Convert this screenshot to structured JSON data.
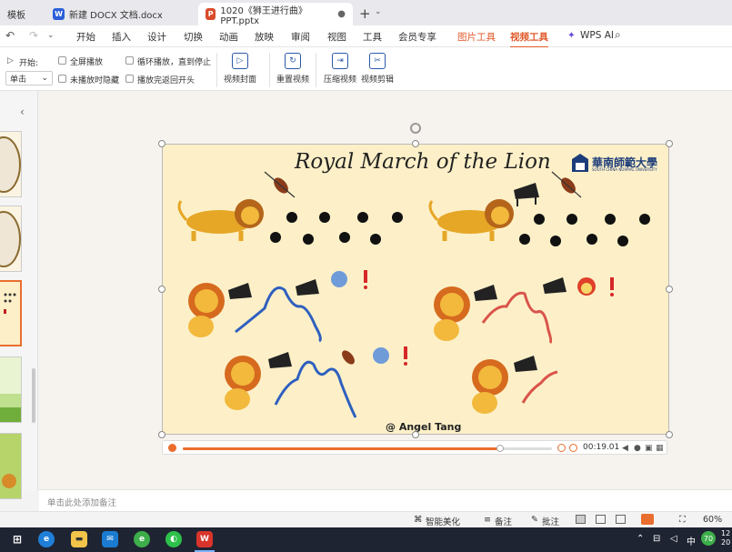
{
  "tabs": [
    {
      "label": "模板",
      "icon": "template-icon"
    },
    {
      "label": "新建 DOCX 文档.docx",
      "badge": "W",
      "badge_color": "#2b5fd9"
    },
    {
      "label": "1020《狮王进行曲》PPT.pptx",
      "badge": "P",
      "badge_color": "#d94b2b",
      "active": true
    }
  ],
  "menu": {
    "items": [
      "开始",
      "插入",
      "设计",
      "切换",
      "动画",
      "放映",
      "审阅",
      "视图",
      "工具",
      "会员专享"
    ],
    "picture_tools": "图片工具",
    "video_tools": "视频工具",
    "wps_ai": "WPS AI"
  },
  "ribbon": {
    "start_label": "开始:",
    "start_value": "单击",
    "fullscreen": "全屏播放",
    "hide_when_not_playing": "未播放时隐藏",
    "loop": "循环播放，直到停止",
    "rewind": "播放完返回开头",
    "cover": "视频封面",
    "reset": "重置视频",
    "compress": "压缩视频",
    "trim": "视频剪辑"
  },
  "slide": {
    "title": "Royal March of the Lion",
    "university": "華南師範大學",
    "university_sub": "SOUTH CHINA NORMAL UNIVERSITY",
    "credit": "@ Angel Tang"
  },
  "video": {
    "time": "00:19.01",
    "progress": 0.86
  },
  "notes_placeholder": "单击此处添加备注",
  "status": {
    "beautify": "智能美化",
    "notes": "备注",
    "comments": "批注",
    "zoom": "60%"
  },
  "taskbar": {
    "apps": [
      "edge",
      "file-explorer",
      "mail",
      "greenapp",
      "wechat",
      "wps"
    ],
    "ime": "中",
    "weather": "70",
    "clock": "12 20"
  }
}
